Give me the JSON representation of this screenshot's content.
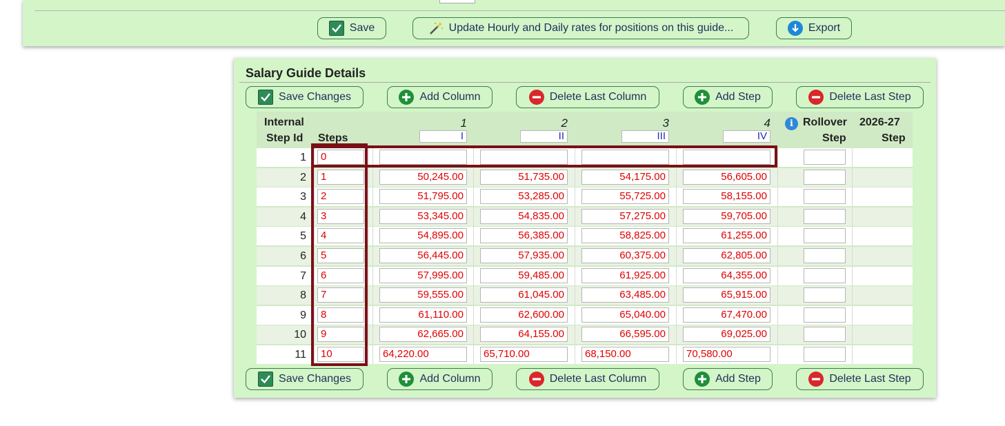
{
  "toolbar": {
    "save_label": "Save",
    "update_rates_label": "Update Hourly and Daily rates for positions on this guide...",
    "export_label": "Export"
  },
  "details": {
    "title": "Salary Guide Details",
    "actions": {
      "save_changes": "Save Changes",
      "add_column": "Add Column",
      "delete_last_column": "Delete Last Column",
      "add_step": "Add Step",
      "delete_last_step": "Delete Last Step"
    },
    "headers": {
      "internal_step_id_1": "Internal",
      "internal_step_id_2": "Step Id",
      "steps": "Steps",
      "rollover_1": "Rollover",
      "rollover_2": "Step",
      "year_1": "2026-27",
      "year_2": "Step"
    },
    "columns": [
      {
        "number": "1",
        "name": "I"
      },
      {
        "number": "2",
        "name": "II"
      },
      {
        "number": "3",
        "name": "III"
      },
      {
        "number": "4",
        "name": "IV"
      }
    ],
    "rows": [
      {
        "id": "1",
        "step": "0",
        "values": [
          "",
          "",
          "",
          ""
        ],
        "rollover": "",
        "next": ""
      },
      {
        "id": "2",
        "step": "1",
        "values": [
          "50,245.00",
          "51,735.00",
          "54,175.00",
          "56,605.00"
        ],
        "rollover": "",
        "next": ""
      },
      {
        "id": "3",
        "step": "2",
        "values": [
          "51,795.00",
          "53,285.00",
          "55,725.00",
          "58,155.00"
        ],
        "rollover": "",
        "next": ""
      },
      {
        "id": "4",
        "step": "3",
        "values": [
          "53,345.00",
          "54,835.00",
          "57,275.00",
          "59,705.00"
        ],
        "rollover": "",
        "next": ""
      },
      {
        "id": "5",
        "step": "4",
        "values": [
          "54,895.00",
          "56,385.00",
          "58,825.00",
          "61,255.00"
        ],
        "rollover": "",
        "next": ""
      },
      {
        "id": "6",
        "step": "5",
        "values": [
          "56,445.00",
          "57,935.00",
          "60,375.00",
          "62,805.00"
        ],
        "rollover": "",
        "next": ""
      },
      {
        "id": "7",
        "step": "6",
        "values": [
          "57,995.00",
          "59,485.00",
          "61,925.00",
          "64,355.00"
        ],
        "rollover": "",
        "next": ""
      },
      {
        "id": "8",
        "step": "7",
        "values": [
          "59,555.00",
          "61,045.00",
          "63,485.00",
          "65,915.00"
        ],
        "rollover": "",
        "next": ""
      },
      {
        "id": "9",
        "step": "8",
        "values": [
          "61,110.00",
          "62,600.00",
          "65,040.00",
          "67,470.00"
        ],
        "rollover": "",
        "next": ""
      },
      {
        "id": "10",
        "step": "9",
        "values": [
          "62,665.00",
          "64,155.00",
          "66,595.00",
          "69,025.00"
        ],
        "rollover": "",
        "next": ""
      },
      {
        "id": "11",
        "step": "10",
        "values": [
          "64,220.00",
          "65,710.00",
          "68,150.00",
          "70,580.00"
        ],
        "rollover": "",
        "next": "",
        "left_aligned": true
      }
    ]
  }
}
